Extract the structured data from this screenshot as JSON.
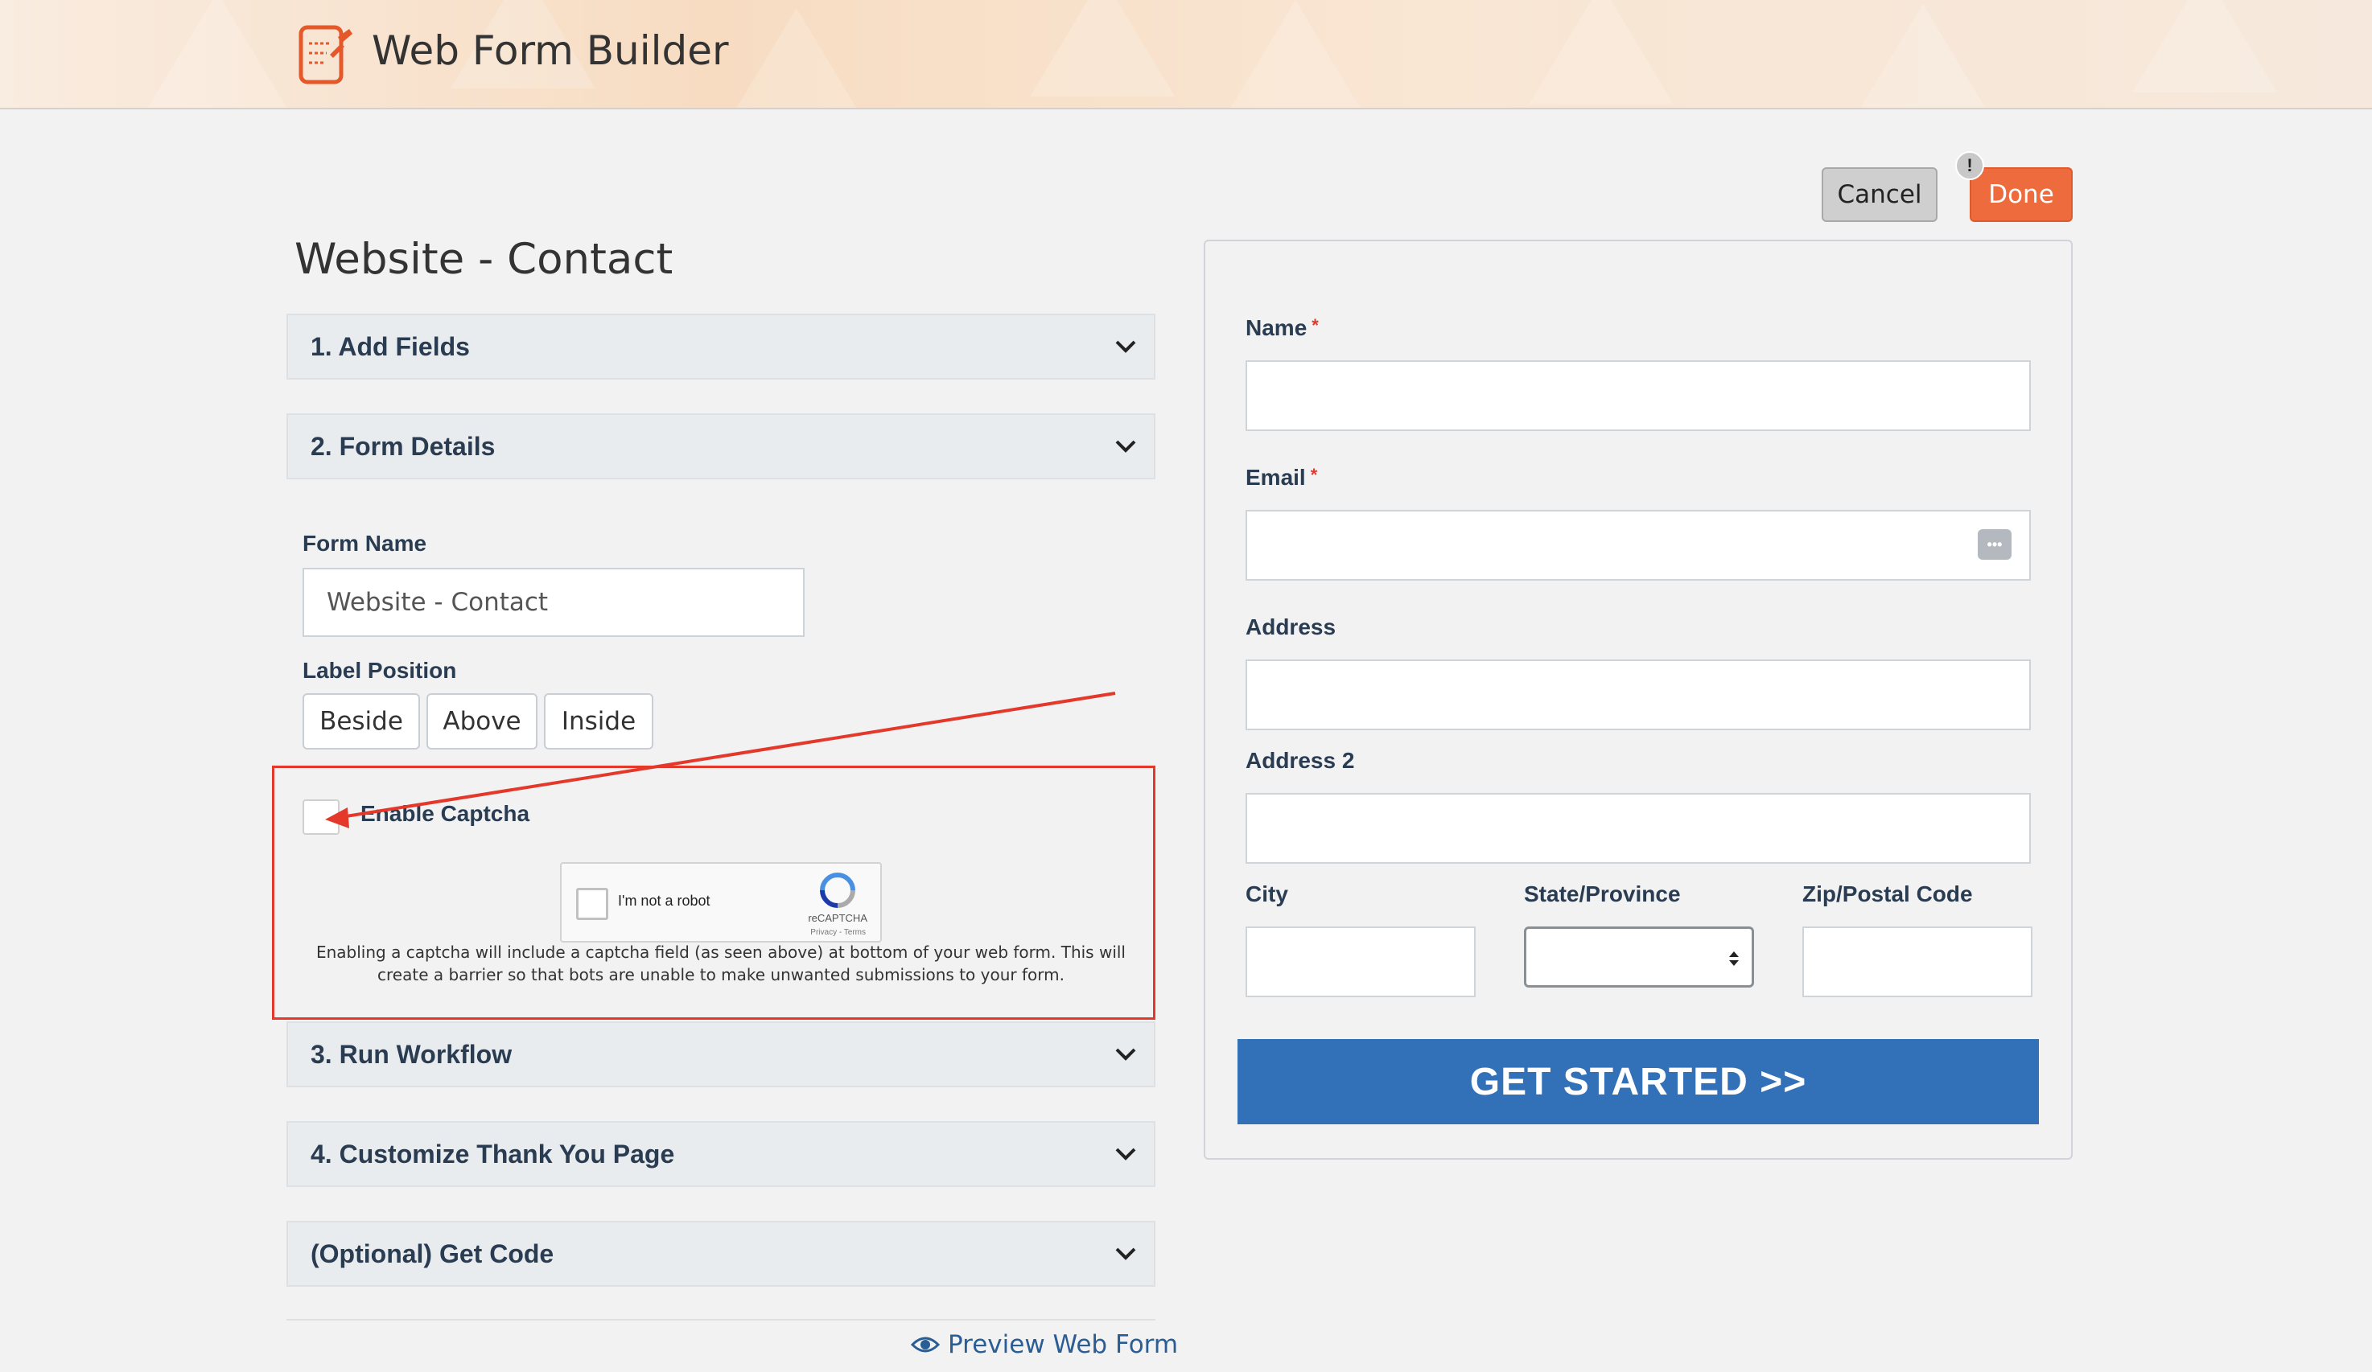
{
  "header": {
    "app_title": "Web Form Builder"
  },
  "toolbar": {
    "cancel_label": "Cancel",
    "done_label": "Done",
    "done_badge": "!"
  },
  "form": {
    "title": "Website - Contact"
  },
  "sections": [
    {
      "label": "1. Add Fields"
    },
    {
      "label": "2. Form Details"
    },
    {
      "label": "3. Run Workflow"
    },
    {
      "label": "4. Customize Thank You Page"
    },
    {
      "label": "(Optional) Get Code"
    }
  ],
  "form_details": {
    "form_name_label": "Form Name",
    "form_name_value": "Website - Contact",
    "label_position_label": "Label Position",
    "label_positions": [
      "Beside",
      "Above",
      "Inside"
    ],
    "captcha_label": "Enable Captcha",
    "captcha_checked": false,
    "recaptcha_text": "I'm not a robot",
    "recaptcha_brand": "reCAPTCHA",
    "recaptcha_terms": "Privacy - Terms",
    "captcha_description": "Enabling a captcha will include a captcha field (as seen above) at bottom of your web form. This will create a barrier so that bots are unable to make unwanted submissions to your form."
  },
  "preview_link": "Preview Web Form",
  "preview_form": {
    "fields": {
      "name": {
        "label": "Name",
        "required": "*"
      },
      "email": {
        "label": "Email",
        "required": "*"
      },
      "address": {
        "label": "Address"
      },
      "address2": {
        "label": "Address 2"
      },
      "city": {
        "label": "City"
      },
      "state": {
        "label": "State/Province"
      },
      "zip": {
        "label": "Zip/Postal Code"
      }
    },
    "submit_label": "GET STARTED >>"
  },
  "colors": {
    "accent": "#ee6b3d",
    "submit": "#3271b8",
    "annotation": "#e4382a"
  },
  "icons": [
    "form-builder-icon",
    "chevron-down-icon",
    "eye-icon",
    "password-manager-icon",
    "recaptcha-logo-icon",
    "annotation-arrow"
  ]
}
